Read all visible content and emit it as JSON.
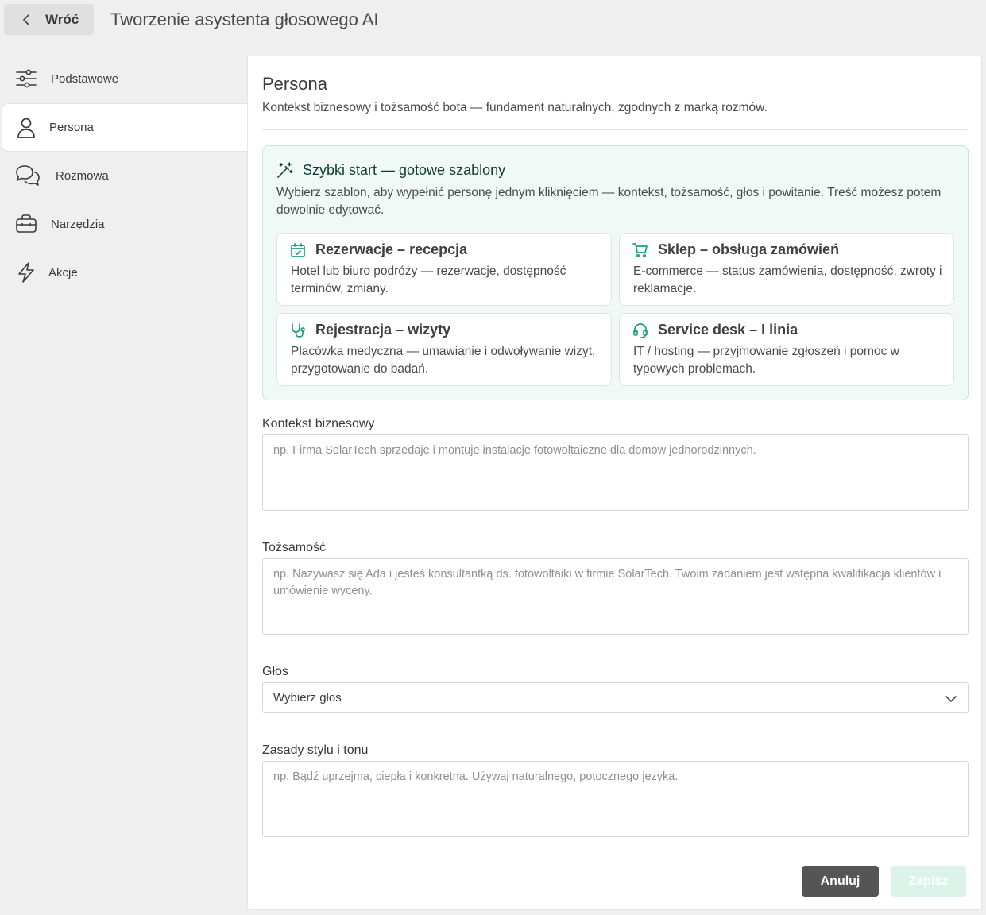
{
  "header": {
    "back_label": "Wróć",
    "title": "Tworzenie asystenta głosowego AI"
  },
  "sidebar": {
    "items": [
      {
        "label": "Podstawowe",
        "icon": "sliders-icon",
        "active": false
      },
      {
        "label": "Persona",
        "icon": "user-icon",
        "active": true
      },
      {
        "label": "Rozmowa",
        "icon": "chat-bubbles-icon",
        "active": false
      },
      {
        "label": "Narzędzia",
        "icon": "toolbox-icon",
        "active": false
      },
      {
        "label": "Akcje",
        "icon": "lightning-icon",
        "active": false
      }
    ]
  },
  "main": {
    "title": "Persona",
    "subtitle": "Kontekst biznesowy i tożsamość bota — fundament naturalnych, zgodnych z marką rozmów.",
    "quick_start": {
      "title": "Szybki start — gotowe szablony",
      "description": "Wybierz szablon, aby wypełnić personę jednym kliknięciem — kontekst, tożsamość, głos i powitanie. Treść możesz potem dowolnie edytować.",
      "templates": [
        {
          "title": "Rezerwacje – recepcja",
          "description": "Hotel lub biuro podróży — rezerwacje, dostępność terminów, zmiany.",
          "icon": "calendar-check-icon"
        },
        {
          "title": "Sklep – obsługa zamówień",
          "description": "E-commerce — status zamówienia, dostępność, zwroty i reklamacje.",
          "icon": "shopping-cart-icon"
        },
        {
          "title": "Rejestracja – wizyty",
          "description": "Placówka medyczna — umawianie i odwoływanie wizyt, przygotowanie do badań.",
          "icon": "stethoscope-icon"
        },
        {
          "title": "Service desk – I linia",
          "description": "IT / hosting — przyjmowanie zgłoszeń i pomoc w typowych problemach.",
          "icon": "headset-icon"
        }
      ]
    },
    "fields": {
      "business_context": {
        "label": "Kontekst biznesowy",
        "value": "",
        "placeholder": "np. Firma SolarTech sprzedaje i montuje instalacje fotowoltaiczne dla domów jednorodzinnych."
      },
      "identity": {
        "label": "Tożsamość",
        "value": "",
        "placeholder": "np. Nazywasz się Ada i jesteś konsultantką ds. fotowoltaiki w firmie SolarTech. Twoim zadaniem jest wstępna kwalifikacja klientów i umówienie wyceny."
      },
      "voice": {
        "label": "Głos",
        "selected": "Wybierz głos"
      },
      "style_rules": {
        "label": "Zasady stylu i tonu",
        "value": "",
        "placeholder": "np. Bądź uprzejma, ciepła i konkretna. Używaj naturalnego, potocznego języka."
      }
    },
    "actions": {
      "cancel_label": "Anuluj",
      "save_label": "Zapisz"
    }
  },
  "colors": {
    "accent": "#1a9e7a",
    "quick_start_bg": "#f0f9f6",
    "quick_start_border": "#bfe8da",
    "cancel_bg": "#555555",
    "save_disabled_bg": "#dcf3ea"
  }
}
